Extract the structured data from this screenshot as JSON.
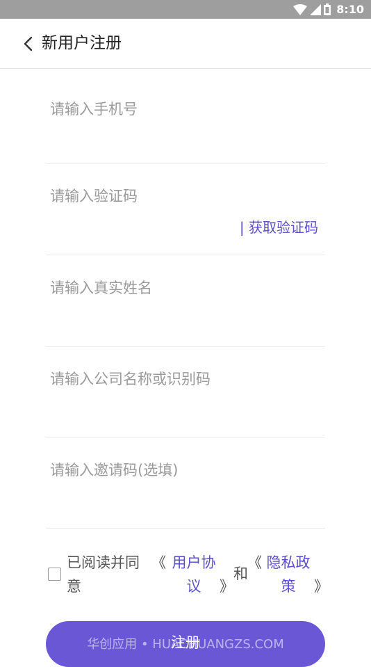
{
  "status_bar": {
    "time": "8:10",
    "icons": [
      "wifi-icon",
      "cell-signal-icon",
      "battery-icon"
    ]
  },
  "header": {
    "title": "新用户注册",
    "back_icon": "chevron-left-icon"
  },
  "form": {
    "phone": {
      "placeholder": "请输入手机号",
      "value": ""
    },
    "code": {
      "placeholder": "请输入验证码",
      "value": "",
      "get_code_label": "| 获取验证码"
    },
    "name": {
      "placeholder": "请输入真实姓名",
      "value": ""
    },
    "company": {
      "placeholder": "请输入公司名称或识别码",
      "value": ""
    },
    "invite": {
      "placeholder": "请输入邀请码(选填)",
      "value": ""
    }
  },
  "agreement": {
    "checked": false,
    "prefix": "已阅读并同意",
    "open_bracket": "《",
    "close_bracket": "》",
    "user_agreement": "用户协议",
    "and": "和",
    "privacy_policy": "隐私政策"
  },
  "register_button": {
    "label": "注册"
  },
  "watermark": "华创应用 • HUACHUANGZS.COM",
  "colors": {
    "accent": "#5b4fc9",
    "button": "#6a57d6",
    "status_bar": "#9e9e9e",
    "placeholder": "#9a9a9a"
  }
}
